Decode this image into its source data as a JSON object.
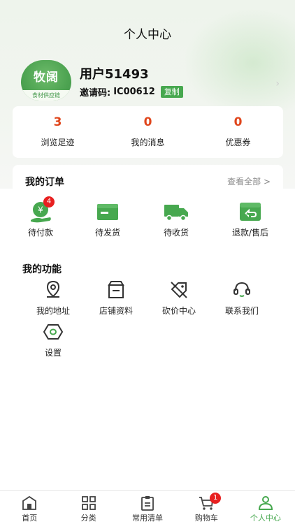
{
  "header": {
    "title": "个人中心"
  },
  "profile": {
    "avatar_text": "牧阔",
    "avatar_subtext": "食材供应链",
    "username": "用户51493",
    "invite_label": "邀请码:",
    "invite_code": "IC00612",
    "copy_label": "复制"
  },
  "stats": [
    {
      "value": "3",
      "label": "浏览足迹"
    },
    {
      "value": "0",
      "label": "我的消息"
    },
    {
      "value": "0",
      "label": "优惠券"
    }
  ],
  "orders": {
    "title": "我的订单",
    "view_all": "查看全部 >",
    "items": [
      {
        "label": "待付款",
        "icon": "payment-icon",
        "badge": "4"
      },
      {
        "label": "待发货",
        "icon": "package-icon"
      },
      {
        "label": "待收货",
        "icon": "truck-icon"
      },
      {
        "label": "退款/售后",
        "icon": "refund-icon"
      }
    ]
  },
  "functions": {
    "title": "我的功能",
    "items": [
      {
        "label": "我的地址",
        "icon": "location-icon"
      },
      {
        "label": "店铺资料",
        "icon": "store-icon"
      },
      {
        "label": "砍价中心",
        "icon": "bargain-tag-icon"
      },
      {
        "label": "联系我们",
        "icon": "headset-icon"
      },
      {
        "label": "设置",
        "icon": "settings-icon"
      }
    ]
  },
  "tabbar": {
    "items": [
      {
        "label": "首页",
        "icon": "home-icon"
      },
      {
        "label": "分类",
        "icon": "category-icon"
      },
      {
        "label": "常用清单",
        "icon": "list-icon"
      },
      {
        "label": "购物车",
        "icon": "cart-icon",
        "badge": "1"
      },
      {
        "label": "个人中心",
        "icon": "person-icon",
        "active": true
      }
    ]
  },
  "colors": {
    "accent": "#47a84f",
    "stat_number": "#e0461c",
    "badge": "#e82020"
  }
}
